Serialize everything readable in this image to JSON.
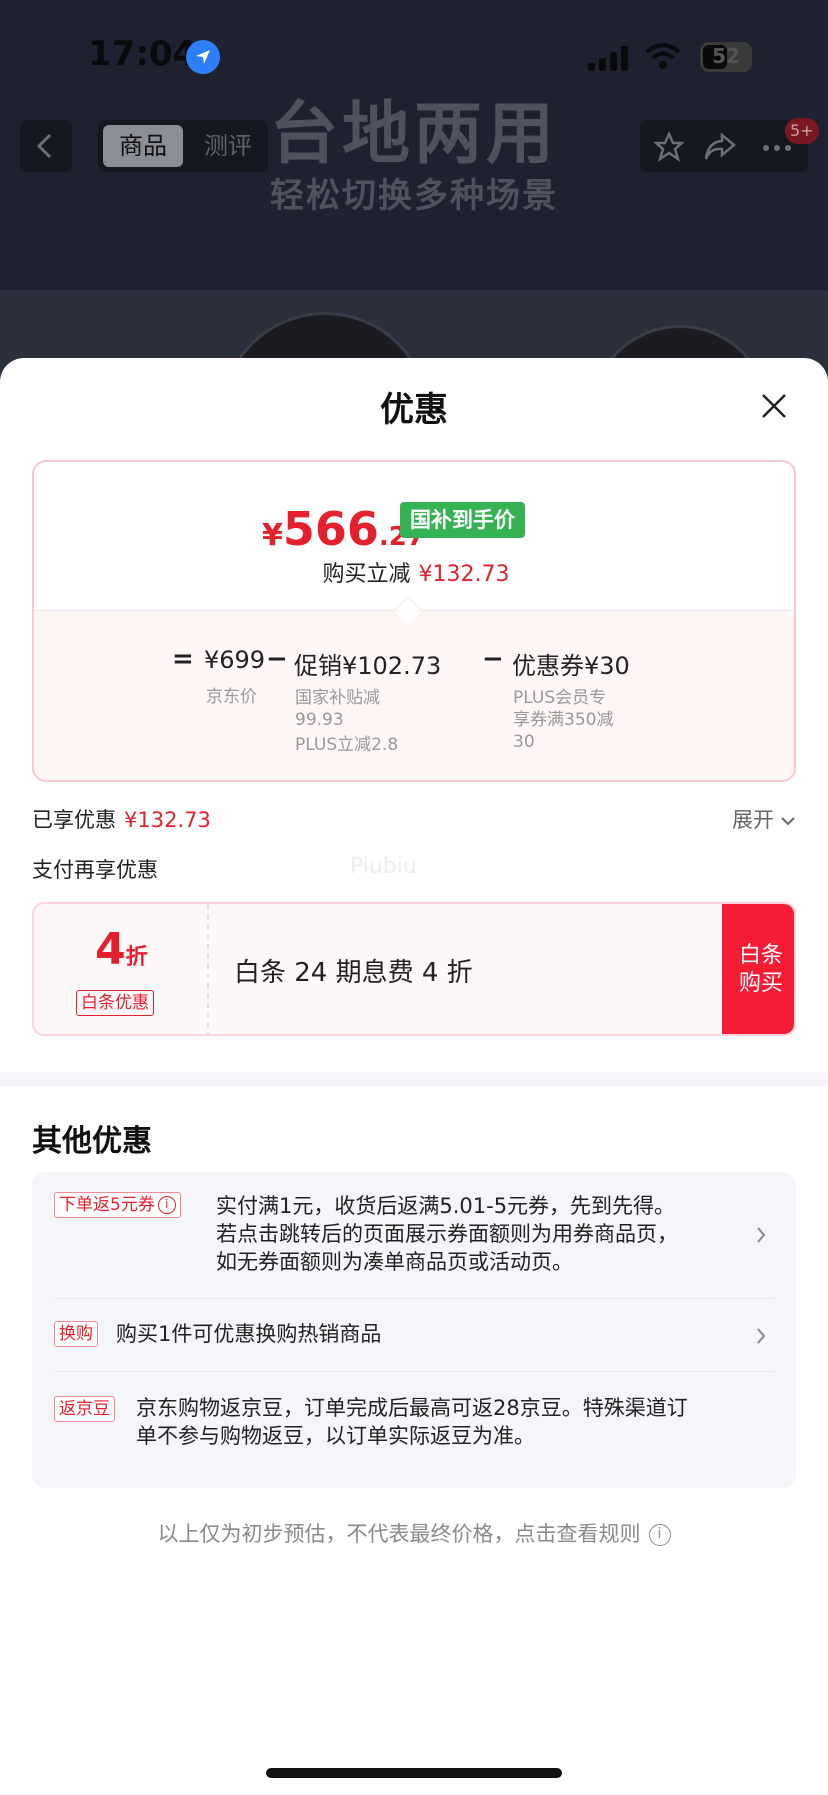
{
  "status": {
    "time": "17:04",
    "battery": "52"
  },
  "nav": {
    "tab_goods": "商品",
    "tab_review": "测评",
    "badge": "5+"
  },
  "banner": {
    "title": "台地两用",
    "subtitle": "轻松切换多种场景"
  },
  "sheet": {
    "title": "优惠"
  },
  "price_card": {
    "currency": "¥",
    "price_int": "566",
    "price_dec": ".27",
    "badge": "国补到手价",
    "reduce_label": "购买立减",
    "reduce_value": "¥132.73",
    "calc": {
      "eq": "=",
      "jd_price": "¥699",
      "jd_price_label": "京东价",
      "minus1": "−",
      "promo": "促销¥102.73",
      "promo_detail_1": "国家补贴减",
      "promo_detail_2": "99.93",
      "promo_detail_3": "PLUS立减2.8",
      "minus2": "−",
      "coupon": "优惠券¥30",
      "coupon_detail_1": "PLUS会员专",
      "coupon_detail_2": "享券满350减",
      "coupon_detail_3": "30"
    }
  },
  "enjoyed": {
    "label": "已享优惠",
    "value": "¥132.73",
    "expand": "展开"
  },
  "pay_more": {
    "label": "支付再享优惠",
    "watermark": "Piubiu"
  },
  "baitiao": {
    "discount_num": "4",
    "discount_unit": "折",
    "tag": "白条优惠",
    "desc": "白条 24 期息费 4 折",
    "buy_line1": "白条",
    "buy_line2": "购买"
  },
  "other": {
    "title": "其他优惠",
    "offers": [
      {
        "tag": "下单返5元券",
        "lines": [
          "实付满1元，收货后返满5.01-5元券，先到先得。",
          "若点击跳转后的页面展示券面额则为用券商品页，",
          "如无券面额则为凑单商品页或活动页。"
        ]
      },
      {
        "tag": "换购",
        "lines": [
          "购买1件可优惠换购热销商品"
        ]
      },
      {
        "tag": "返京豆",
        "lines": [
          "京东购物返京豆，订单完成后最高可返28京豆。特殊渠道订",
          "单不参与购物返豆，以订单实际返豆为准。"
        ]
      }
    ]
  },
  "disclaimer": "以上仅为初步预估，不代表最终价格，点击查看规则"
}
